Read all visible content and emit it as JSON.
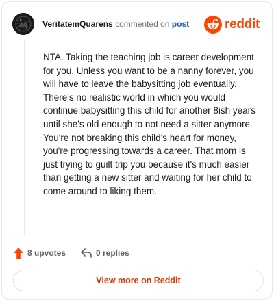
{
  "header": {
    "username": "VeritatemQuarens",
    "action": "commented on",
    "post_link": "post",
    "brand": "reddit"
  },
  "comment": {
    "text": "NTA. Taking the teaching job is career development for you. Unless you want to be a nanny forever, you will have to leave the babysitting job eventually. There's no realistic world in which you would continue babysitting this child for another 8ish years until she's old enough to not need a sitter anymore. You're not breaking this child's heart for money, you're progressing towards a career. That mom is just trying to guilt trip you because it's much easier than getting a new sitter and waiting for her child to come around to liking them."
  },
  "footer": {
    "upvotes": "8 upvotes",
    "replies": "0 replies",
    "view_more": "View more on Reddit"
  },
  "colors": {
    "brand": "#ff4500",
    "link": "#1e5ea7",
    "view_more": "#d93a00"
  }
}
